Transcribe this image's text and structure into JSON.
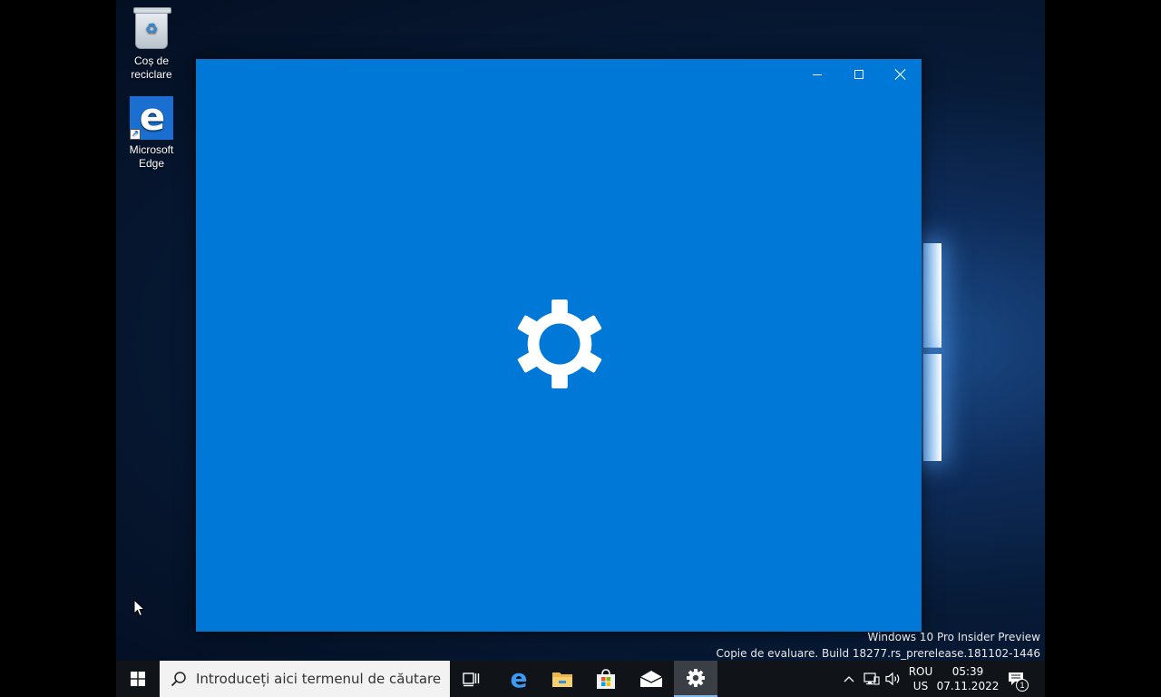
{
  "desktop": {
    "icons": [
      {
        "label_line1": "Coș de",
        "label_line2": "reciclare",
        "icon": "recycle-bin-icon"
      },
      {
        "label_line1": "Microsoft",
        "label_line2": "Edge",
        "icon": "edge-shortcut-icon"
      }
    ],
    "watermark": {
      "line1": "Windows 10 Pro Insider Preview",
      "line2": "Copie de evaluare. Build 18277.rs_prerelease.181102-1446"
    }
  },
  "settings_window": {
    "background_color": "#0078d7",
    "splash_icon": "gear-icon",
    "caption_buttons": [
      "minimize",
      "maximize",
      "close"
    ]
  },
  "taskbar": {
    "search_placeholder": "Introduceți aici termenul de căutare",
    "pinned": [
      "task-view-icon",
      "edge-icon",
      "file-explorer-icon",
      "store-icon",
      "mail-icon",
      "settings-icon"
    ],
    "active_app": "settings",
    "tray": {
      "lang_line1": "ROU",
      "lang_line2": "US",
      "time": "05:39",
      "date": "07.11.2022",
      "notification_count": "1"
    }
  }
}
